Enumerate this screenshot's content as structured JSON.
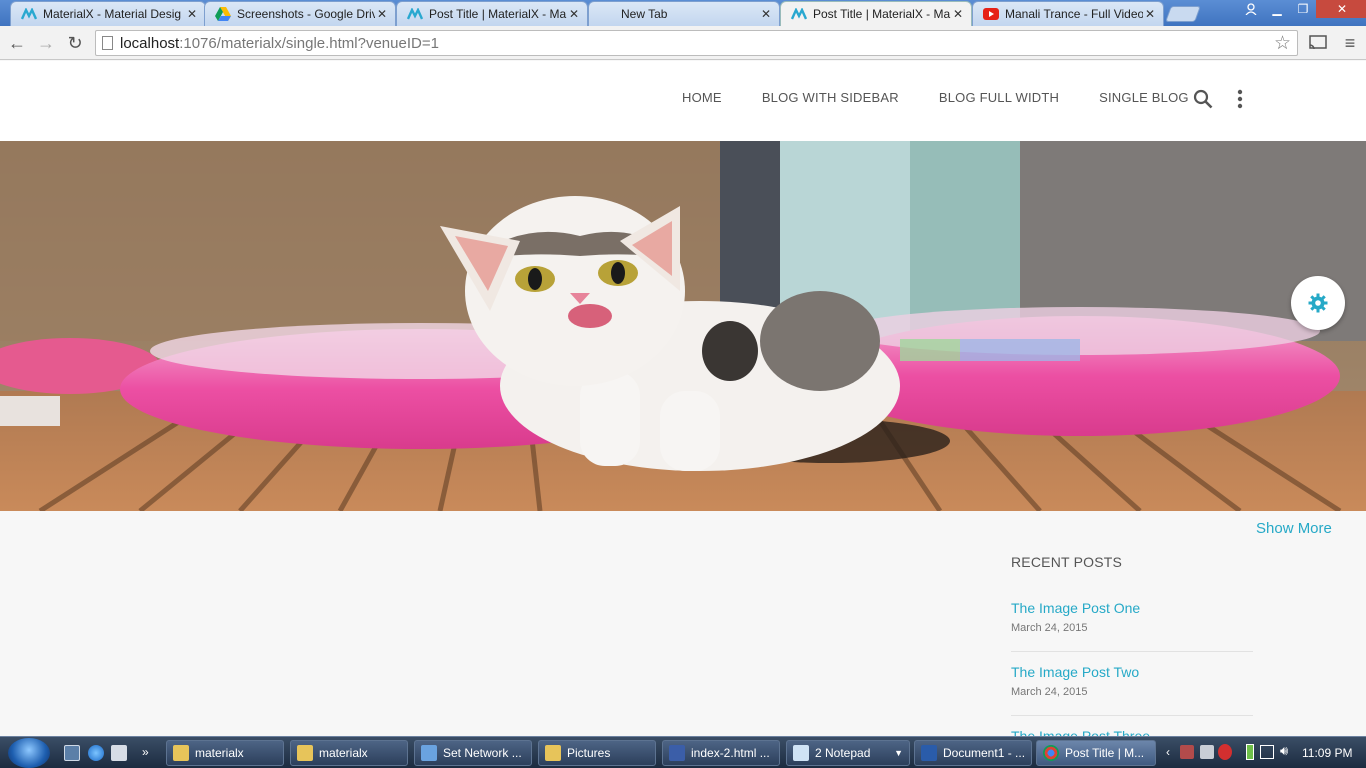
{
  "browser": {
    "tabs": [
      {
        "title": "MaterialX - Material Desig",
        "icon": "materialx-icon",
        "active": false
      },
      {
        "title": "Screenshots - Google Driv",
        "icon": "google-drive-icon",
        "active": false
      },
      {
        "title": "Post Title | MaterialX - Ma",
        "icon": "materialx-icon",
        "active": false
      },
      {
        "title": "New Tab",
        "icon": "",
        "active": false
      },
      {
        "title": "Post Title | MaterialX - Ma",
        "icon": "materialx-icon",
        "active": true
      },
      {
        "title": "Manali Trance - Full Video",
        "icon": "youtube-icon",
        "active": false
      }
    ],
    "url_host": "localhost",
    "url_rest": ":1076/materialx/single.html?venueID=1"
  },
  "site": {
    "nav": [
      "HOME",
      "BLOG WITH SIDEBAR",
      "BLOG FULL WIDTH",
      "SINGLE BLOG"
    ],
    "show_more": "Show More",
    "recent_title": "RECENT POSTS",
    "recent_posts": [
      {
        "title": "The Image Post One",
        "date": "March 24, 2015"
      },
      {
        "title": "The Image Post Two",
        "date": "March 24, 2015"
      },
      {
        "title": "The Image Post Three",
        "date": ""
      }
    ],
    "slider_active_index": 1,
    "accent": "#26a9c7"
  },
  "taskbar": {
    "items": [
      {
        "label": "materialx",
        "icon": "folder-icon"
      },
      {
        "label": "materialx",
        "icon": "folder-icon"
      },
      {
        "label": "Set Network ...",
        "icon": "network-icon"
      },
      {
        "label": "Pictures",
        "icon": "folder-icon"
      },
      {
        "label": "index-2.html ...",
        "icon": "browser-icon"
      },
      {
        "label": "2 Notepad",
        "icon": "notepad-icon"
      },
      {
        "label": "Document1 - ...",
        "icon": "word-icon"
      },
      {
        "label": "Post Title | M...",
        "icon": "chrome-icon"
      }
    ],
    "clock": "11:09 PM"
  }
}
